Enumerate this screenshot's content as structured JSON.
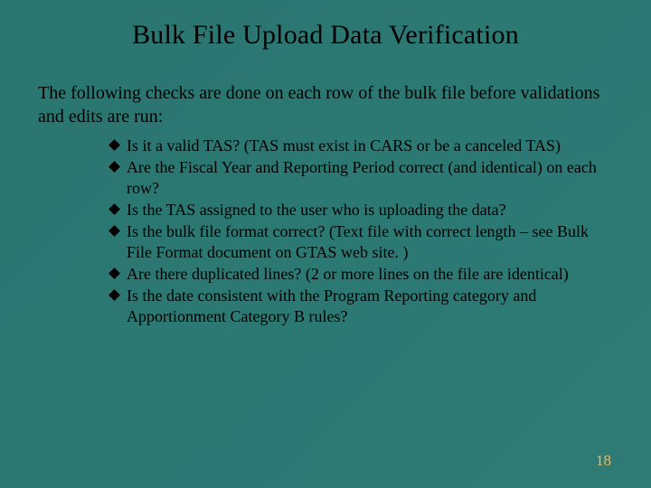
{
  "title": "Bulk File Upload Data Verification",
  "intro": "The following checks are done on each row of the bulk file before validations and edits are run:",
  "bullets": {
    "items": [
      {
        "text": "Is it a valid TAS? (TAS must exist in CARS or be a canceled TAS)"
      },
      {
        "text": "Are the Fiscal Year and Reporting Period correct (and identical) on each row?"
      },
      {
        "text": "Is the TAS assigned to the user who is uploading the data?"
      },
      {
        "text": "Is the bulk file format correct? (Text file with correct length – see Bulk File Format document on GTAS web site. )"
      },
      {
        "text": "Are there duplicated lines? (2 or more lines on the file are identical)"
      },
      {
        "text": "Is the date consistent with the Program Reporting category and Apportionment Category B rules?"
      }
    ]
  },
  "pageNumber": "18"
}
